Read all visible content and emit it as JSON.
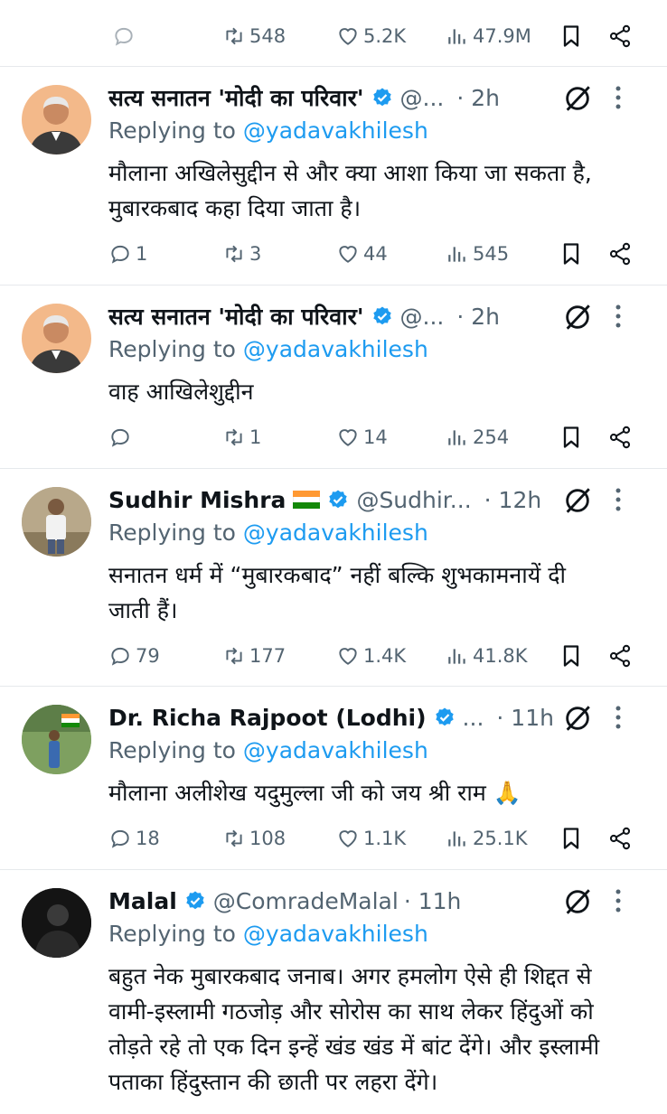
{
  "top": {
    "retweets": "548",
    "likes": "5.2K",
    "views": "47.9M"
  },
  "replying_label": "Replying to",
  "replying_handle": "@yadavakhilesh",
  "tweets": [
    {
      "name": "सत्य सनातन 'मोदी का परिवार'",
      "handle": "@...",
      "time": "· 2h",
      "lines": [
        "मौलाना अखिलेसुद्दीन से और क्या आशा किया जा सकता है,",
        "मुबारकबाद कहा दिया जाता है।"
      ],
      "replies": "1",
      "retweets": "3",
      "likes": "44",
      "views": "545"
    },
    {
      "name": "सत्य सनातन 'मोदी का परिवार'",
      "handle": "@...",
      "time": "· 2h",
      "lines": [
        "वाह आखिलेशुद्दीन"
      ],
      "replies": "",
      "retweets": "1",
      "likes": "14",
      "views": "254"
    },
    {
      "name": "Sudhir Mishra",
      "handle": "@Sudhir...",
      "time": "· 12h",
      "lines": [
        "सनातन धर्म में “मुबारकबाद” नहीं बल्कि शुभकामनायें दी",
        "जाती हैं।"
      ],
      "replies": "79",
      "retweets": "177",
      "likes": "1.4K",
      "views": "41.8K"
    },
    {
      "name": "Dr. Richa Rajpoot (Lodhi)",
      "handle": "...",
      "time": "· 11h",
      "lines": [
        "मौलाना अलीशेख यदुमुल्ला जी को जय श्री राम 🙏"
      ],
      "replies": "18",
      "retweets": "108",
      "likes": "1.1K",
      "views": "25.1K"
    },
    {
      "name": "Malal",
      "handle": "@ComradeMalal",
      "time": "· 11h",
      "lines": [
        "बहुत नेक मुबारकबाद जनाब। अगर हमलोग ऐसे ही शिद्दत से",
        "वामी-इस्लामी गठजोड़ और सोरोस का साथ लेकर हिंदुओं को",
        "तोड़ते रहे तो एक दिन इन्हें खंड खंड में बांट देंगे। और इस्लामी",
        "पताका हिंदुस्तान की छाती पर लहरा देंगे।"
      ]
    }
  ],
  "colors": {
    "accent": "#1d9bf0",
    "muted": "#536471",
    "text": "#0f1419",
    "border": "#e6e9ec"
  },
  "icons": [
    "reply-icon",
    "retweet-icon",
    "like-icon",
    "views-icon",
    "bookmark-icon",
    "share-icon",
    "verified-icon",
    "grok-icon",
    "more-icon"
  ]
}
